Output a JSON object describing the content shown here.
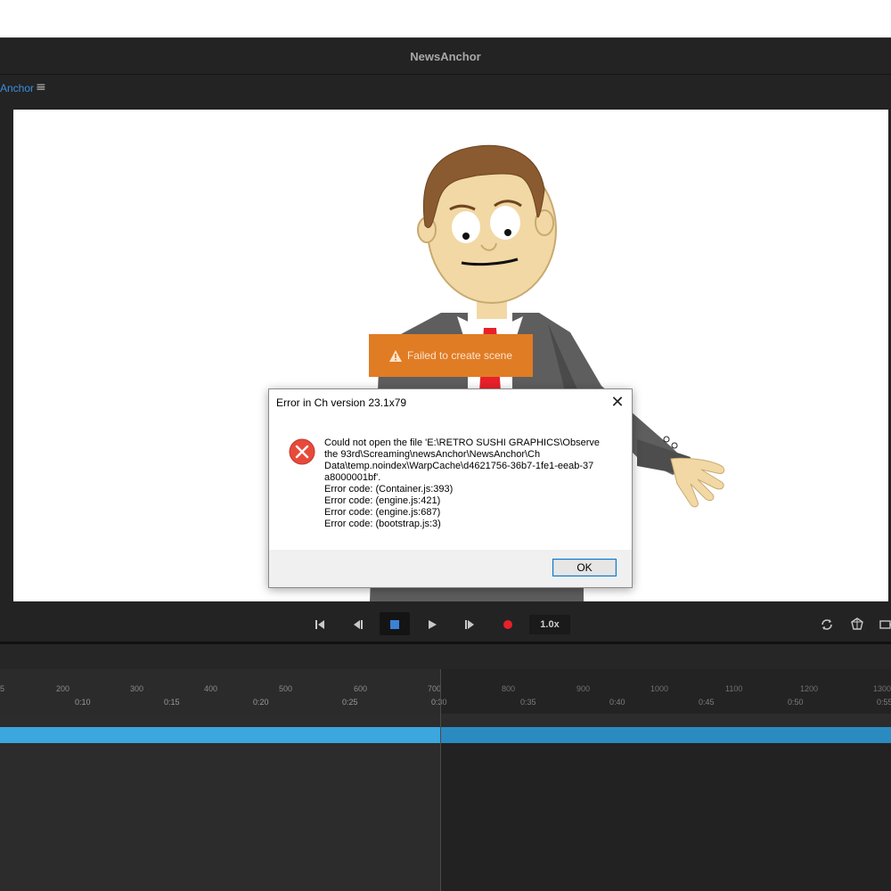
{
  "app": {
    "title": "NewsAnchor"
  },
  "panel": {
    "tab_label": "Anchor",
    "menu_icon": "hamburger-icon"
  },
  "toast": {
    "text": "Failed to create scene",
    "icon": "warning-icon",
    "color": "#e07c24"
  },
  "dialog": {
    "title": "Error in Ch version 23.1x79",
    "icon": "error-icon",
    "message_lines": [
      "Could not open the file 'E:\\RETRO SUSHI GRAPHICS\\Observe",
      "the 93rd\\Screaming\\newsAnchor\\NewsAnchor\\Ch",
      "Data\\temp.noindex\\WarpCache\\d4621756-36b7-1fe1-eeab-37",
      "a8000001bf'.",
      "Error code: (Container.js:393)",
      "Error code: (engine.js:421)",
      "Error code: (engine.js:687)",
      "Error code: (bootstrap.js:3)"
    ],
    "ok_label": "OK"
  },
  "transport": {
    "speed": "1.0x",
    "buttons": [
      "go-to-start-icon",
      "step-back-icon",
      "stop-icon",
      "play-icon",
      "step-forward-icon",
      "record-icon"
    ],
    "right_icons": [
      "refresh-icon",
      "puppet-icon",
      "camera-icon"
    ]
  },
  "timeline": {
    "frames": [
      "5",
      "200",
      "300",
      "400",
      "500",
      "600",
      "700",
      "800",
      "900",
      "1000",
      "1100",
      "1200",
      "1300"
    ],
    "times": [
      "0:10",
      "0:15",
      "0:20",
      "0:25",
      "0:30",
      "0:35",
      "0:40",
      "0:45",
      "0:50",
      "0:55"
    ],
    "track_color": "#3ca6df"
  }
}
